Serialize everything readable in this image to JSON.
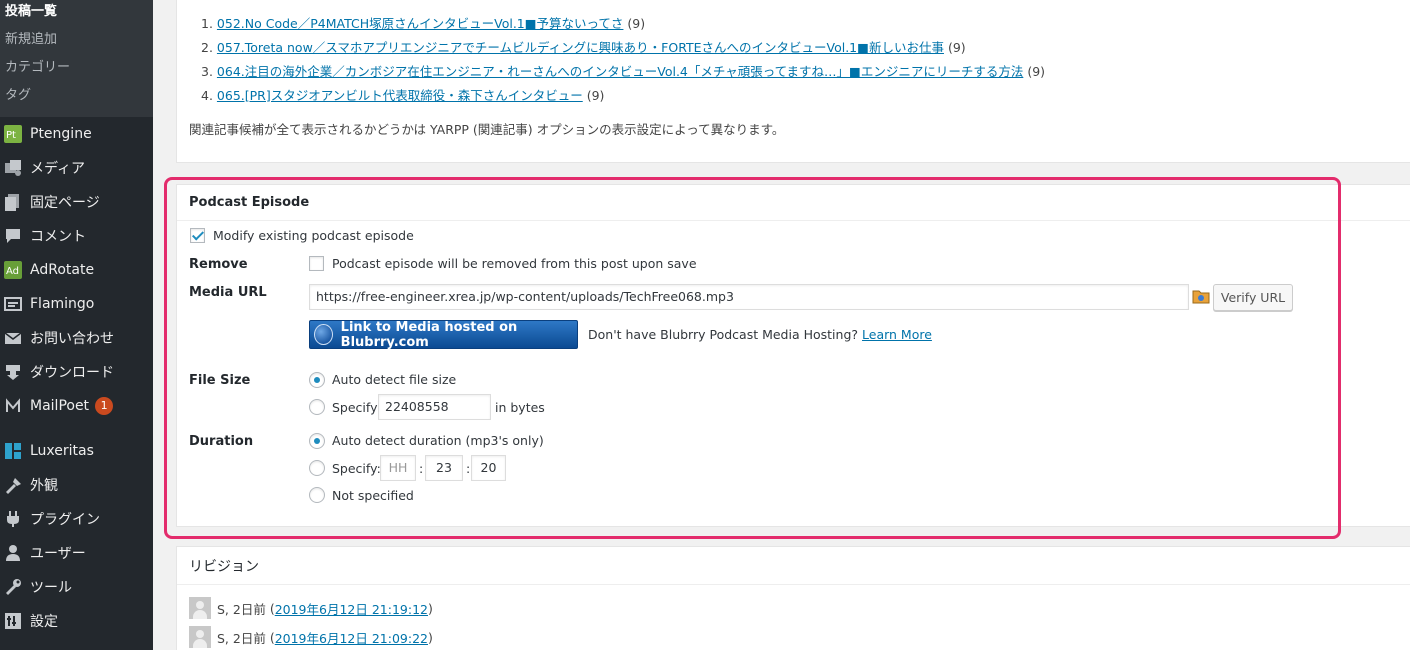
{
  "sidebar": {
    "submenu": [
      {
        "label": "投稿一覧",
        "current": true
      },
      {
        "label": "新規追加"
      },
      {
        "label": "カテゴリー"
      },
      {
        "label": "タグ"
      }
    ],
    "menu": [
      {
        "label": "Ptengine",
        "icon": "ptengine-icon"
      },
      {
        "label": "メディア",
        "icon": "media-icon"
      },
      {
        "label": "固定ページ",
        "icon": "page-icon"
      },
      {
        "label": "コメント",
        "icon": "comment-icon"
      },
      {
        "label": "AdRotate",
        "icon": "adrotate-icon"
      },
      {
        "label": "Flamingo",
        "icon": "flamingo-icon"
      },
      {
        "label": "お問い合わせ",
        "icon": "mail-icon"
      },
      {
        "label": "ダウンロード",
        "icon": "download-icon"
      },
      {
        "label": "MailPoet",
        "icon": "mailpoet-icon",
        "badge": "1"
      },
      {
        "label": "Luxeritas",
        "icon": "luxeritas-icon"
      },
      {
        "label": "外観",
        "icon": "appearance-icon"
      },
      {
        "label": "プラグイン",
        "icon": "plugin-icon"
      },
      {
        "label": "ユーザー",
        "icon": "user-icon"
      },
      {
        "label": "ツール",
        "icon": "tools-icon"
      },
      {
        "label": "設定",
        "icon": "settings-icon"
      }
    ]
  },
  "yarpp": {
    "items": [
      {
        "num": "1.",
        "title": "052.No Code／P4MATCH塚原さんインタビューVol.1■予算ないってさ",
        "count": "(9)"
      },
      {
        "num": "2.",
        "title": "057.Toreta now／スマホアプリエンジニアでチームビルディングに興味あり・FORTEさんへのインタビューVol.1■新しいお仕事",
        "count": "(9)"
      },
      {
        "num": "3.",
        "title": "064.注目の海外企業／カンボジア在住エンジニア・れーさんへのインタビューVol.4「メチャ頑張ってますね…」■エンジニアにリーチする方法",
        "count": "(9)"
      },
      {
        "num": "4.",
        "title": "065.[PR]スタジオアンビルト代表取締役・森下さんインタビュー",
        "count": "(9)"
      }
    ],
    "note": "関連記事候補が全て表示されるかどうかは YARPP (関連記事) オプションの表示設定によって異なります。"
  },
  "podcast": {
    "title": "Podcast Episode",
    "modify_label": "Modify existing podcast episode",
    "modify_checked": true,
    "remove_label": "Remove",
    "remove_text": "Podcast episode will be removed from this post upon save",
    "remove_checked": false,
    "media_url_label": "Media URL",
    "media_url_value": "https://free-engineer.xrea.jp/wp-content/uploads/TechFree068.mp3",
    "verify_label": "Verify URL",
    "blubrry_button": "Link to Media hosted on Blubrry.com",
    "hosting_text": "Don't have Blubrry Podcast Media Hosting?",
    "learn_more": "Learn More",
    "file_size_label": "File Size",
    "auto_size_label": "Auto detect file size",
    "specify_label": "Specify:",
    "size_value": "22408558",
    "in_bytes": "in bytes",
    "duration_label": "Duration",
    "auto_duration_label": "Auto detect duration (mp3's only)",
    "hh_placeholder": "HH",
    "mm_value": "23",
    "ss_value": "20",
    "colon": ":",
    "not_specified": "Not specified",
    "highlight_color": "#e32c6c"
  },
  "revisions": {
    "title": "リビジョン",
    "rows": [
      {
        "author": "S, 2日前",
        "date": "2019年6月12日 21:19:12"
      },
      {
        "author": "S, 2日前",
        "date": "2019年6月12日 21:09:22"
      }
    ]
  }
}
